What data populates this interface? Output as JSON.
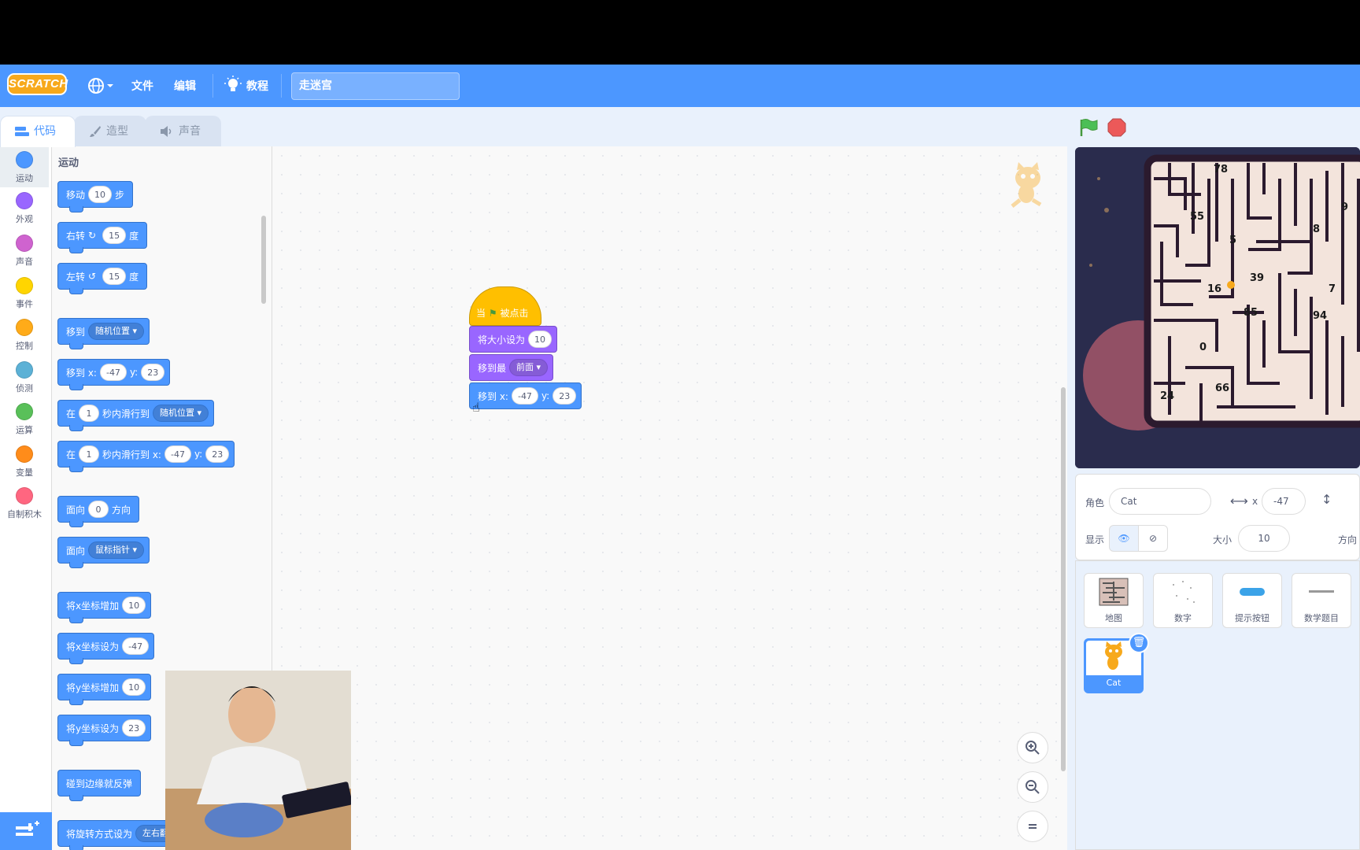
{
  "menubar": {
    "logo": "SCRATCH",
    "file": "文件",
    "edit": "编辑",
    "tutorials": "教程",
    "project_title": "走迷宫"
  },
  "tabs": {
    "code": "代码",
    "costumes": "造型",
    "sounds": "声音"
  },
  "categories": [
    {
      "label": "运动",
      "color": "#4c97ff"
    },
    {
      "label": "外观",
      "color": "#9966ff"
    },
    {
      "label": "声音",
      "color": "#cf63cf"
    },
    {
      "label": "事件",
      "color": "#ffd500"
    },
    {
      "label": "控制",
      "color": "#ffab19"
    },
    {
      "label": "侦测",
      "color": "#5cb1d6"
    },
    {
      "label": "运算",
      "color": "#59c059"
    },
    {
      "label": "变量",
      "color": "#ff8c1a"
    },
    {
      "label": "自制积木",
      "color": "#ff6680"
    }
  ],
  "palette": {
    "title": "运动",
    "move": {
      "a": "移动",
      "v": "10",
      "b": "步"
    },
    "turn_right": {
      "a": "右转",
      "v": "15",
      "b": "度"
    },
    "turn_left": {
      "a": "左转",
      "v": "15",
      "b": "度"
    },
    "goto": {
      "a": "移到",
      "d": "随机位置"
    },
    "goto_xy": {
      "a": "移到 x:",
      "x": "-47",
      "y_lbl": "y:",
      "y": "23"
    },
    "glide": {
      "a": "在",
      "v": "1",
      "b": "秒内滑行到",
      "d": "随机位置"
    },
    "glide_xy": {
      "a": "在",
      "v": "1",
      "b": "秒内滑行到 x:",
      "x": "-47",
      "y_lbl": "y:",
      "y": "23"
    },
    "point_dir": {
      "a": "面向",
      "v": "0",
      "b": "方向"
    },
    "point_towards": {
      "a": "面向",
      "d": "鼠标指针"
    },
    "change_x": {
      "a": "将x坐标增加",
      "v": "10"
    },
    "set_x": {
      "a": "将x坐标设为",
      "v": "-47"
    },
    "change_y": {
      "a": "将y坐标增加",
      "v": "10"
    },
    "set_y": {
      "a": "将y坐标设为",
      "v": "23"
    },
    "bounce": {
      "a": "碰到边缘就反弹"
    },
    "rotation": {
      "a": "将旋转方式设为",
      "d": "左右翻"
    }
  },
  "script": {
    "hat": {
      "a": "当",
      "b": "被点击"
    },
    "size": {
      "a": "将大小设为",
      "v": "10"
    },
    "front": {
      "a": "移到最",
      "d": "前面"
    },
    "goto": {
      "a": "移到 x:",
      "x": "-47",
      "y_lbl": "y:",
      "y": "23"
    }
  },
  "maze_numbers": [
    {
      "t": "78"
    },
    {
      "t": "55"
    },
    {
      "t": "9"
    },
    {
      "t": "8"
    },
    {
      "t": "5"
    },
    {
      "t": "39"
    },
    {
      "t": "16"
    },
    {
      "t": "7"
    },
    {
      "t": "85"
    },
    {
      "t": "94"
    },
    {
      "t": "0"
    },
    {
      "t": "66"
    },
    {
      "t": "24"
    }
  ],
  "sprite_info": {
    "sprite_label": "角色",
    "sprite_name": "Cat",
    "x_label": "x",
    "x": "-47",
    "show_label": "显示",
    "size_label": "大小",
    "size": "10",
    "direction_label": "方向"
  },
  "sprites": [
    {
      "name": "地图"
    },
    {
      "name": "数字"
    },
    {
      "name": "提示按钮"
    },
    {
      "name": "数学题目"
    },
    {
      "name": "Cat"
    }
  ]
}
